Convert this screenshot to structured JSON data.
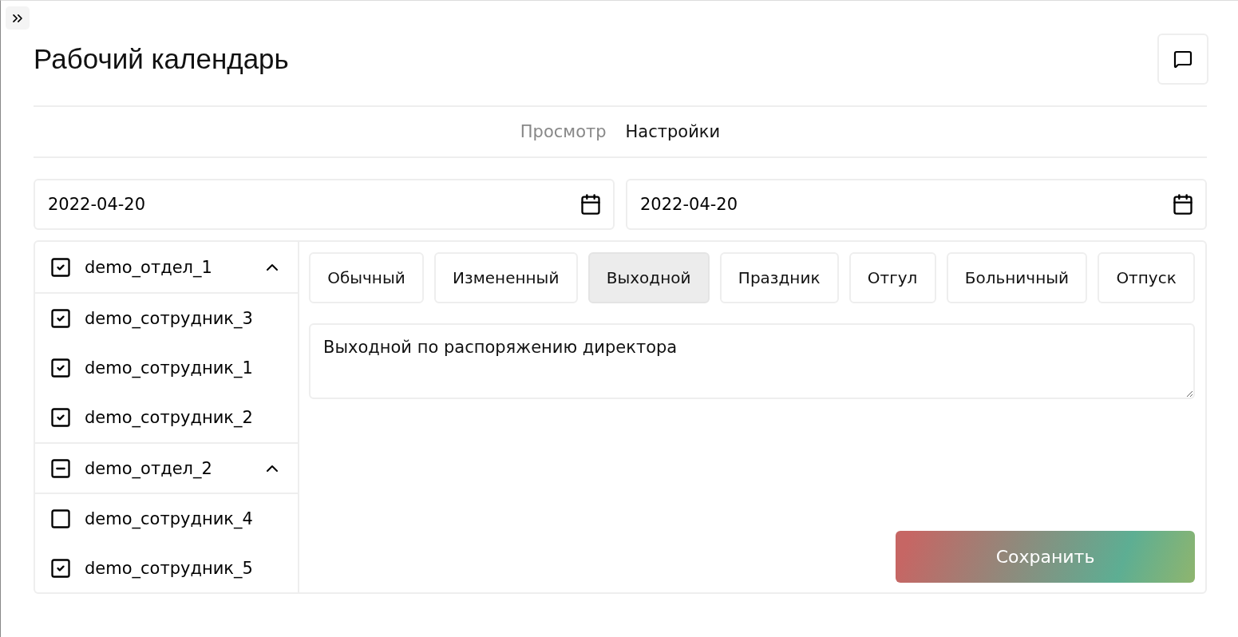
{
  "header": {
    "title": "Рабочий календарь"
  },
  "tabs": [
    {
      "label": "Просмотр",
      "selected": false
    },
    {
      "label": "Настройки",
      "selected": true
    }
  ],
  "date_range": [
    {
      "value": "2022-04-20"
    },
    {
      "value": "2022-04-20"
    }
  ],
  "departments": [
    {
      "name": "demo_отдел_1",
      "checked": true,
      "indeterminate": false,
      "expanded": true,
      "children": [
        {
          "name": "demo_сотрудник_3",
          "checked": true
        },
        {
          "name": "demo_сотрудник_1",
          "checked": true
        },
        {
          "name": "demo_сотрудник_2",
          "checked": true
        }
      ]
    },
    {
      "name": "demo_отдел_2",
      "indeterminate": true,
      "expanded": true,
      "children": [
        {
          "name": "demo_сотрудник_4",
          "checked": false
        },
        {
          "name": "demo_сотрудник_5",
          "checked": true
        }
      ]
    }
  ],
  "day_types": [
    {
      "label": "Обычный",
      "selected": false
    },
    {
      "label": "Измененный",
      "selected": false
    },
    {
      "label": "Выходной",
      "selected": true
    },
    {
      "label": "Праздник",
      "selected": false
    },
    {
      "label": "Отгул",
      "selected": false
    },
    {
      "label": "Больничный",
      "selected": false
    },
    {
      "label": "Отпуск",
      "selected": false
    }
  ],
  "comment": {
    "value": "Выходной по распоряжению директора"
  },
  "save_button": "Сохранить"
}
